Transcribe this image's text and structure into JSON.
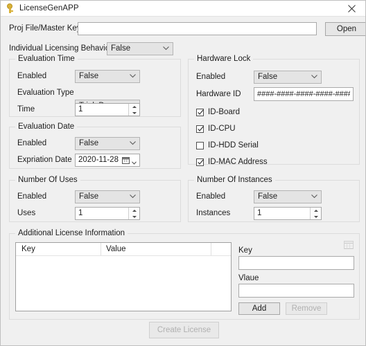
{
  "window": {
    "title": "LicenseGenAPP",
    "app_icon": "key-icon",
    "close_icon": "close-icon"
  },
  "top": {
    "proj_label": "Proj File/Master Key",
    "proj_value": "",
    "proj_placeholder": "",
    "open_button": "Open",
    "ilb_label": "Individual Licensing Behaviour",
    "ilb_value": "False"
  },
  "evaluation_time": {
    "legend": "Evaluation Time",
    "enabled_label": "Enabled",
    "enabled_value": "False",
    "type_label": "Evaluation Type",
    "type_value": "Trial_Days",
    "time_label": "Time",
    "time_value": "1"
  },
  "evaluation_date": {
    "legend": "Evaluation Date",
    "enabled_label": "Enabled",
    "enabled_value": "False",
    "expiration_label": "Expriation Date",
    "expiration_value": "2020-11-28"
  },
  "number_of_uses": {
    "legend": "Number Of Uses",
    "enabled_label": "Enabled",
    "enabled_value": "False",
    "uses_label": "Uses",
    "uses_value": "1"
  },
  "hardware_lock": {
    "legend": "Hardware Lock",
    "enabled_label": "Enabled",
    "enabled_value": "False",
    "hwid_label": "Hardware ID",
    "hwid_value": "####-####-####-####-####",
    "checkboxes": [
      {
        "label": "ID-Board",
        "checked": true
      },
      {
        "label": "ID-CPU",
        "checked": true
      },
      {
        "label": "ID-HDD Serial",
        "checked": false
      },
      {
        "label": "ID-MAC Address",
        "checked": true
      }
    ]
  },
  "number_of_instances": {
    "legend": "Number Of Instances",
    "enabled_label": "Enabled",
    "enabled_value": "False",
    "instances_label": "Instances",
    "instances_value": "1"
  },
  "additional": {
    "legend": "Additional License Information",
    "columns": [
      "Key",
      "Value"
    ],
    "rows": [],
    "key_label": "Key",
    "key_value": "",
    "value_label": "Vlaue",
    "value_value": "",
    "add_button": "Add",
    "remove_button": "Remove",
    "remove_disabled": true,
    "grid_icon": "table-grid-icon"
  },
  "footer": {
    "create_button": "Create License",
    "create_disabled": true
  },
  "colors": {
    "window_bg": "#f0f0f0",
    "titlebar_bg": "#ffffff",
    "field_bg": "#ffffff",
    "combo_bg": "#e4e4e4",
    "button_bg": "#e6e6e6",
    "border": "#a9a9a9",
    "group_border": "#dcdcdc",
    "disabled_text": "#b0b0b0",
    "icon_gold": "#d9b23a"
  }
}
